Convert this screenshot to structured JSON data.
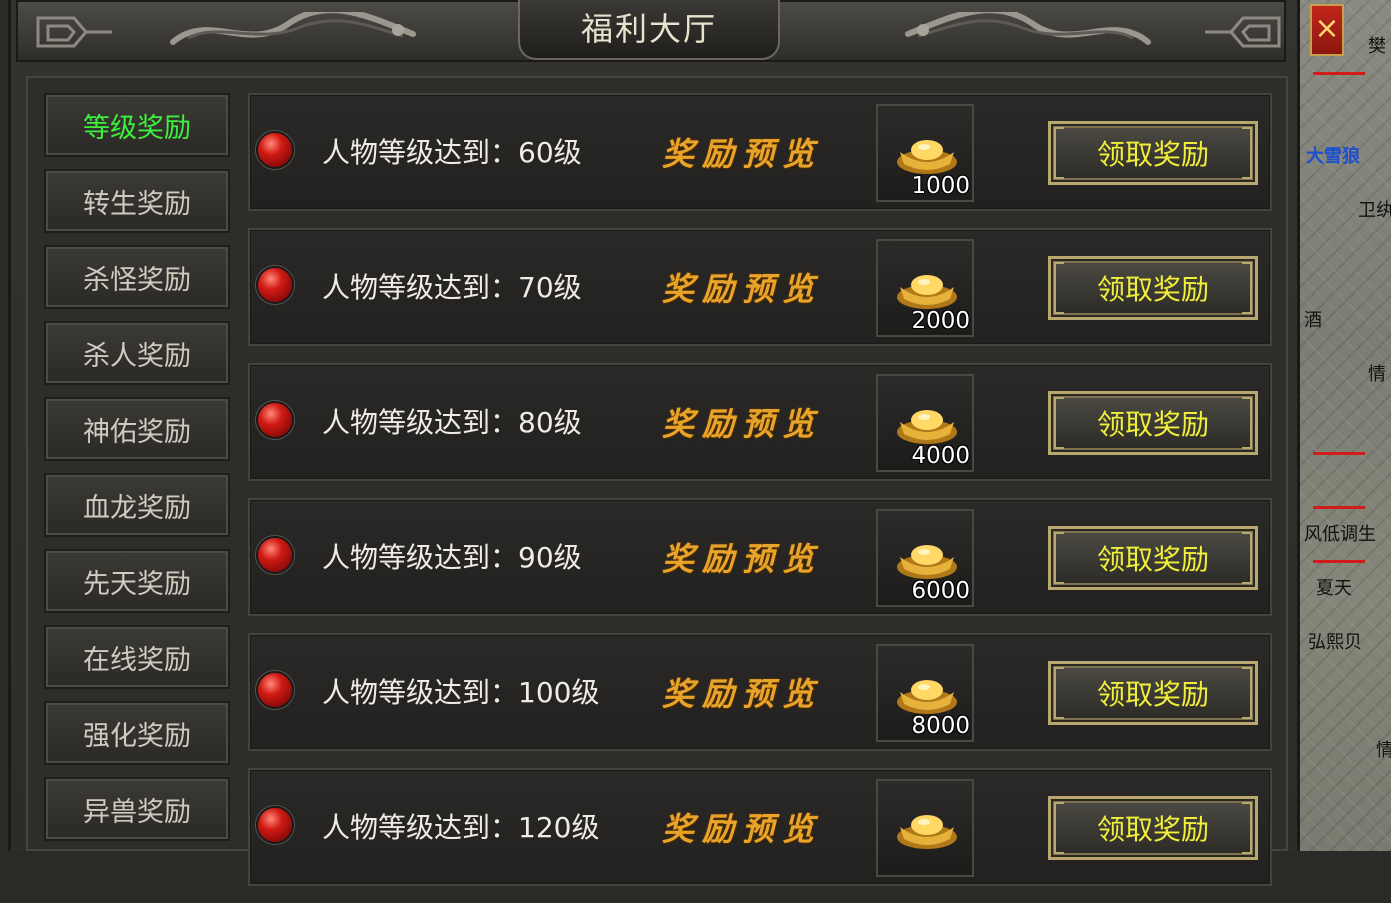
{
  "window": {
    "title": "福利大厅",
    "close_label": "×"
  },
  "sidebar": {
    "tabs": [
      {
        "label": "等级奖励",
        "active": true
      },
      {
        "label": "转生奖励"
      },
      {
        "label": "杀怪奖励"
      },
      {
        "label": "杀人奖励"
      },
      {
        "label": "神佑奖励"
      },
      {
        "label": "血龙奖励"
      },
      {
        "label": "先天奖励"
      },
      {
        "label": "在线奖励"
      },
      {
        "label": "强化奖励"
      },
      {
        "label": "异兽奖励"
      }
    ]
  },
  "rewards": [
    {
      "condition": "人物等级达到：60级",
      "preview": "奖励预览",
      "item": "gold-ingot",
      "quantity": "1000",
      "button": "领取奖励"
    },
    {
      "condition": "人物等级达到：70级",
      "preview": "奖励预览",
      "item": "gold-ingot",
      "quantity": "2000",
      "button": "领取奖励"
    },
    {
      "condition": "人物等级达到：80级",
      "preview": "奖励预览",
      "item": "gold-ingot",
      "quantity": "4000",
      "button": "领取奖励"
    },
    {
      "condition": "人物等级达到：90级",
      "preview": "奖励预览",
      "item": "gold-ingot",
      "quantity": "6000",
      "button": "领取奖励"
    },
    {
      "condition": "人物等级达到：100级",
      "preview": "奖励预览",
      "item": "gold-ingot",
      "quantity": "8000",
      "button": "领取奖励"
    },
    {
      "condition": "人物等级达到：120级",
      "preview": "奖励预览",
      "item": "gold-ingot",
      "quantity": "",
      "button": "领取奖励"
    }
  ],
  "map_labels": [
    {
      "text": "樊"
    },
    {
      "text": "大雪狼"
    },
    {
      "text": "卫纨"
    },
    {
      "text": "酒"
    },
    {
      "text": "情"
    },
    {
      "text": "风低调生"
    },
    {
      "text": "夏天"
    },
    {
      "text": "弘熙贝"
    },
    {
      "text": "情"
    }
  ],
  "colors": {
    "active_tab": "#3cf03c",
    "claim_text": "#f2ef3a",
    "preview_text": "#e8a32a",
    "status_dot": "#d11a14",
    "close_bg": "#c0261b"
  }
}
